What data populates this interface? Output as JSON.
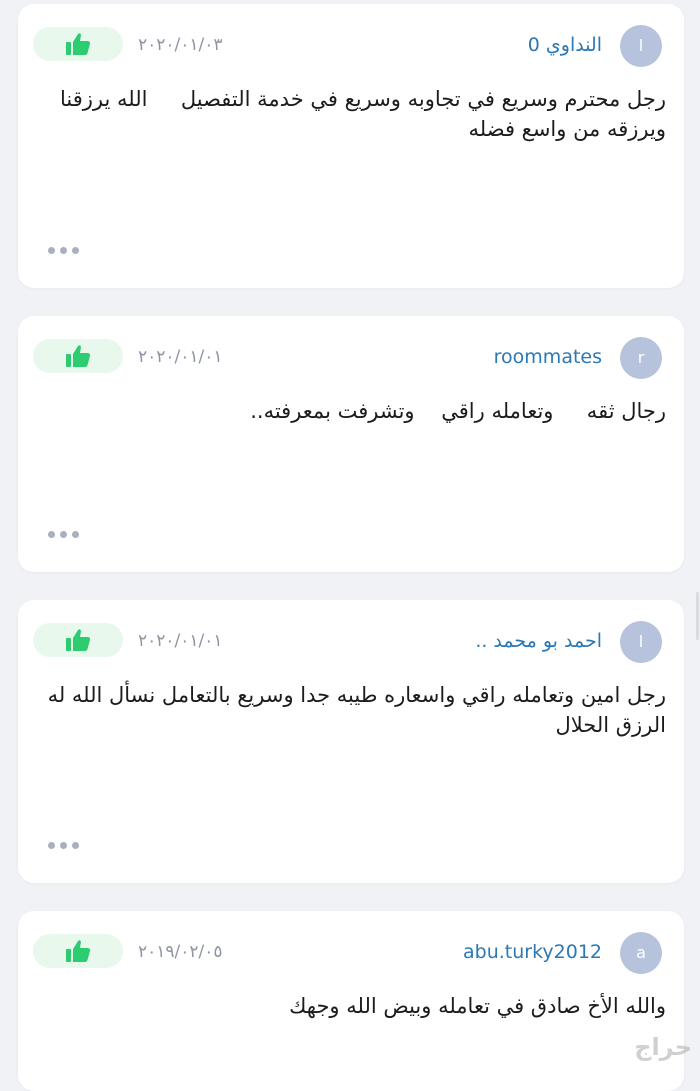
{
  "reviews": [
    {
      "avatar_letter": "ا",
      "username": "النداوي 0",
      "date": "٢٠٢٠/٠١/٠٣",
      "comment": "رجل محترم وسريع في تجاوبه وسريع في خدمة التفصيل     الله يرزقنا ويرزقه من واسع فضله"
    },
    {
      "avatar_letter": "r",
      "username": "roommates",
      "date": "٢٠٢٠/٠١/٠١",
      "comment": "رجال ثقه     وتعامله راقي    وتشرفت بمعرفته.."
    },
    {
      "avatar_letter": "ا",
      "username": "احمد بو محمد  ..",
      "date": "٢٠٢٠/٠١/٠١",
      "comment": "رجل امين وتعامله راقي واسعاره طيبه جدا وسريع بالتعامل نسأل الله له الرزق الحلال"
    },
    {
      "avatar_letter": "a",
      "username": "abu.turky2012",
      "date": "٢٠١٩/٠٢/٠٥",
      "comment": "والله الأخ صادق في تعامله وبيض الله وجهك"
    }
  ],
  "icons": {
    "like": "thumbs-up-icon",
    "more": "more-dots-icon"
  },
  "watermark": "حراج",
  "colors": {
    "username": "#2b78b5",
    "like_bg": "#e9f8ec",
    "like_icon": "#2ecc71",
    "avatar_bg": "#b7c3dc"
  }
}
